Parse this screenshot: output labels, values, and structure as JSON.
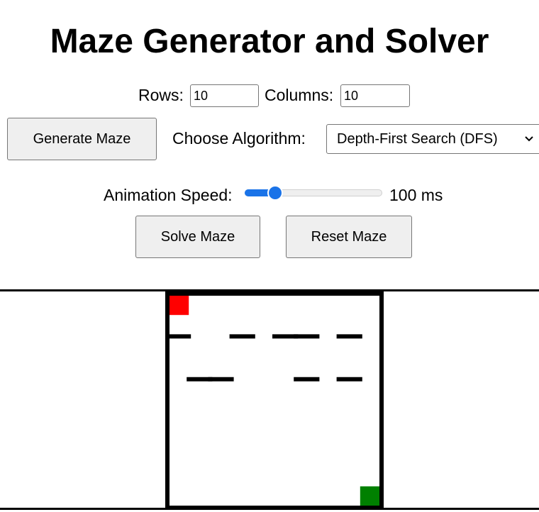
{
  "title": "Maze Generator and Solver",
  "controls": {
    "rows_label": "Rows:",
    "rows_value": "10",
    "columns_label": "Columns:",
    "columns_value": "10",
    "generate_label": "Generate Maze",
    "algorithm_label": "Choose Algorithm:",
    "algorithm_selected": "Depth-First Search (DFS)",
    "speed_label": "Animation Speed:",
    "speed_value": 100,
    "speed_min": 10,
    "speed_max": 500,
    "speed_text": "100 ms",
    "solve_label": "Solve Maze",
    "reset_label": "Reset Maze"
  },
  "maze": {
    "rows": 10,
    "cols": 10,
    "start_cell": [
      0,
      0
    ],
    "end_cell": [
      9,
      9
    ],
    "start_color": "#ff0000",
    "end_color": "#008000",
    "wall_color": "#000000",
    "horizontal_walls": [
      "1111111111",
      "0000000000",
      "1001011010",
      "0000000000",
      "0110001010",
      "0000000000",
      "0000000000",
      "0000000000",
      "0000000000",
      "0000000000",
      "1111111111"
    ],
    "vertical_walls": [
      "10000000001",
      "10000000001",
      "10000000001",
      "10000000001",
      "10000000001",
      "10000000001",
      "10000000001",
      "10000000001",
      "10000000001",
      "10000000001"
    ]
  },
  "colors": {
    "accent": "#1a73e8",
    "button_bg": "#efefef"
  }
}
